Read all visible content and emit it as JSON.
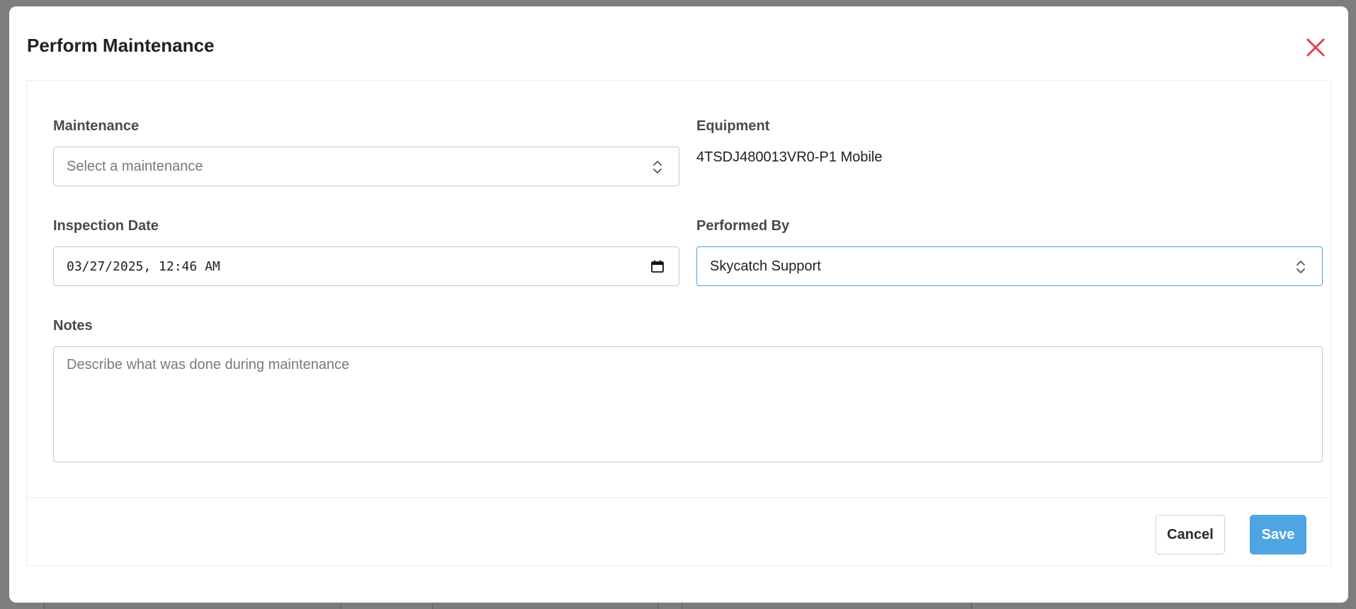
{
  "modal": {
    "title": "Perform Maintenance",
    "close_icon": "close-icon"
  },
  "form": {
    "maintenance": {
      "label": "Maintenance",
      "placeholder": "Select a maintenance"
    },
    "equipment": {
      "label": "Equipment",
      "value": "4TSDJ480013VR0-P1 Mobile"
    },
    "inspection_date": {
      "label": "Inspection Date",
      "value": "03/27/2025, 12:46 AM"
    },
    "performed_by": {
      "label": "Performed By",
      "value": "Skycatch Support"
    },
    "notes": {
      "label": "Notes",
      "placeholder": "Describe what was done during maintenance"
    }
  },
  "footer": {
    "cancel_label": "Cancel",
    "save_label": "Save"
  },
  "colors": {
    "accent": "#4da5e4",
    "close": "#e0424f",
    "focus_border": "#4ba3dc"
  }
}
